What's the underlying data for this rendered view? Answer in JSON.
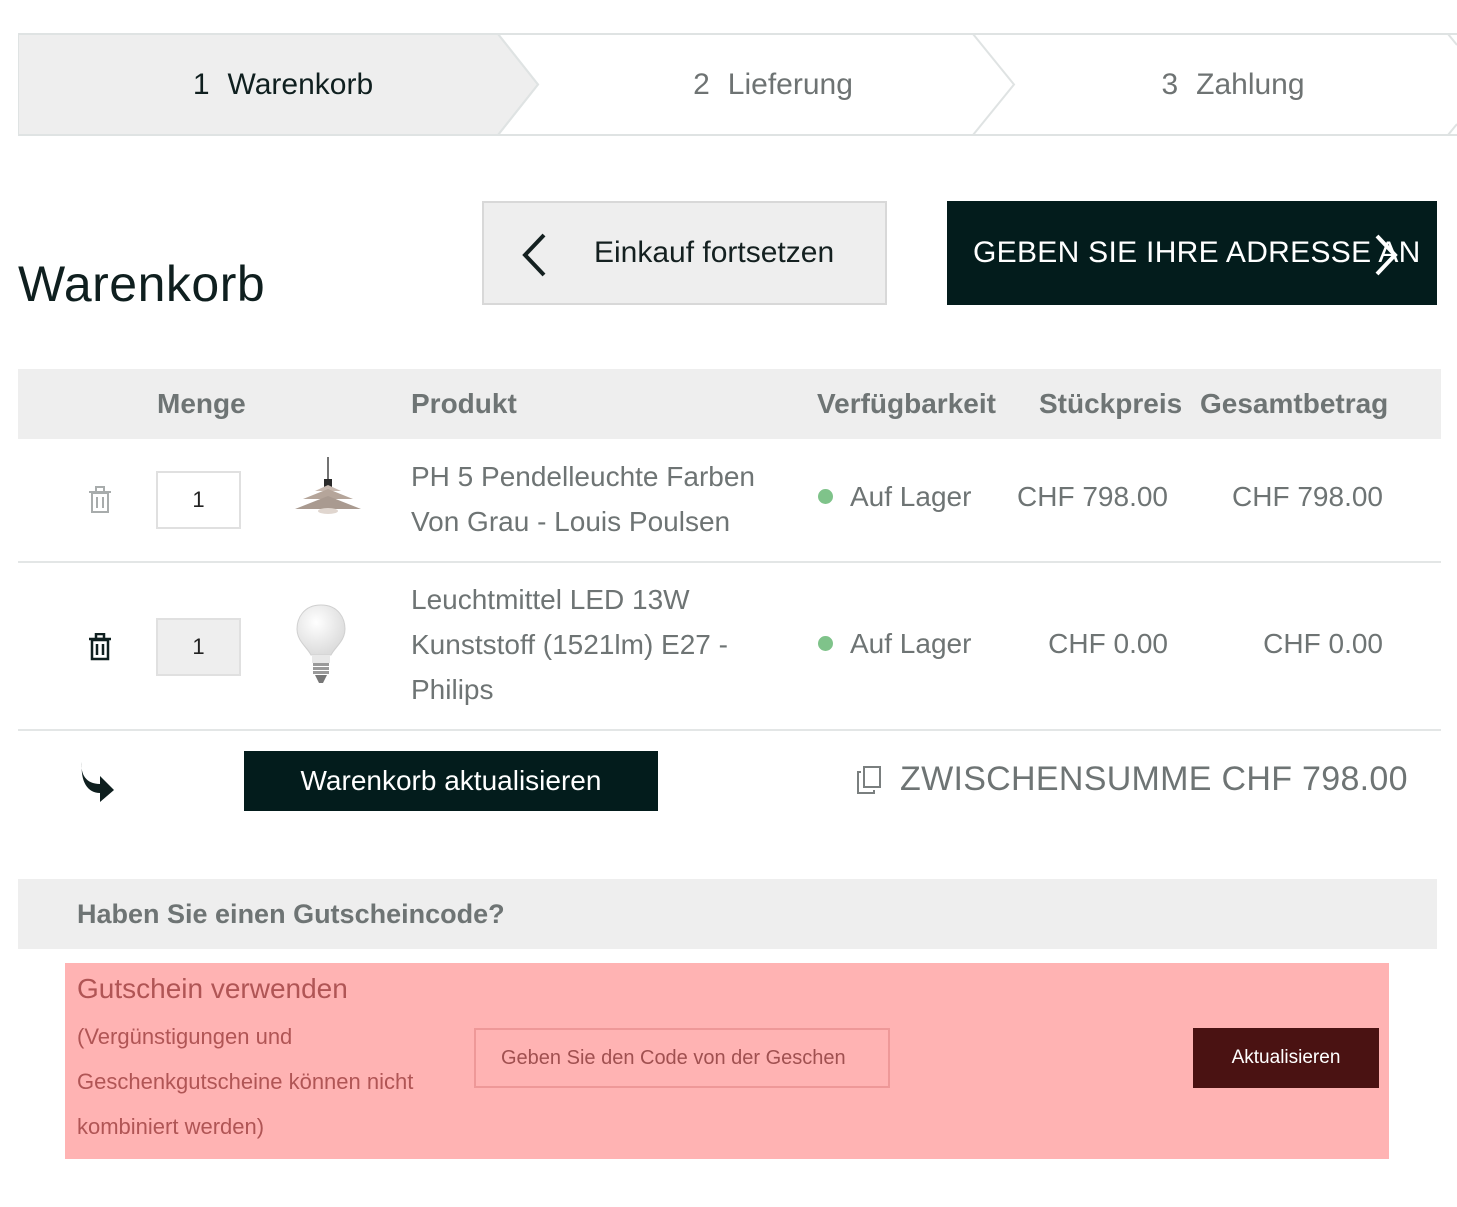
{
  "steps": [
    {
      "num": "1",
      "label": "Warenkorb",
      "active": true
    },
    {
      "num": "2",
      "label": "Lieferung",
      "active": false
    },
    {
      "num": "3",
      "label": "Zahlung",
      "active": false
    }
  ],
  "page_title": "Warenkorb",
  "buttons": {
    "continue_label": "Einkauf fortsetzen",
    "address_label": "GEBEN SIE IHRE ADRESSE AN",
    "update_cart_label": "Warenkorb aktualisieren"
  },
  "table": {
    "headers": {
      "quantity": "Menge",
      "product": "Produkt",
      "availability": "Verfügbarkeit",
      "unit_price": "Stückpreis",
      "total": "Gesamtbetrag"
    },
    "rows": [
      {
        "qty": "1",
        "name": "PH 5 Pendelleuchte Farben Von Grau - Louis Poulsen",
        "thumb_icon": "pendant-lamp-icon",
        "availability": "Auf Lager",
        "unit_price": "CHF 798.00",
        "total": "CHF 798.00"
      },
      {
        "qty": "1",
        "name": "Leuchtmittel LED 13W Kunststoff (1521lm) E27 - Philips",
        "thumb_icon": "light-bulb-icon",
        "availability": "Auf Lager",
        "unit_price": "CHF 0.00",
        "total": "CHF 0.00"
      }
    ]
  },
  "subtotal": "ZWISCHENSUMME CHF 798.00",
  "coupon": {
    "question": "Haben Sie einen Gutscheincode?",
    "title": "Gutschein verwenden",
    "note": "(Vergünstigungen und Geschenkgutscheine können nicht kombiniert werden)",
    "input_placeholder": "Geben Sie den Code von der Geschen",
    "apply_label": "Aktualisieren"
  },
  "colors": {
    "dark": "#031c1c",
    "muted_text": "#6e7474",
    "header_bg": "#eeeeee",
    "in_stock_dot": "#7fc38a",
    "coupon_bg": "#ffb3b3",
    "coupon_button": "#4a1212"
  }
}
